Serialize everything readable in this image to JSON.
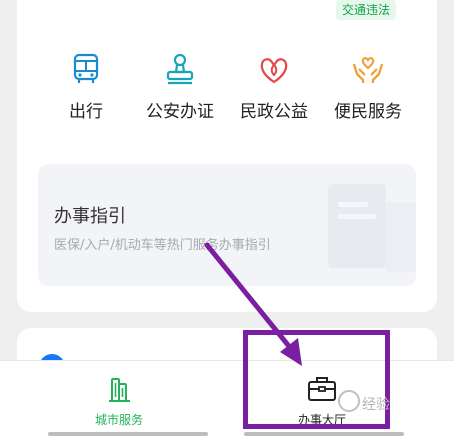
{
  "top_card": {
    "tag": "交通违法",
    "services": [
      {
        "label": "出行",
        "icon": "bus-icon"
      },
      {
        "label": "公安办证",
        "icon": "stamp-icon"
      },
      {
        "label": "民政公益",
        "icon": "heart-flower-icon"
      },
      {
        "label": "便民服务",
        "icon": "hands-heart-icon"
      }
    ],
    "guide": {
      "title": "办事指引",
      "subtitle": "医保/入户/机动车等热门服务办事指引"
    }
  },
  "tabbar": {
    "tabs": [
      {
        "label": "城市服务",
        "icon": "city-buildings-icon",
        "active": true
      },
      {
        "label": "办事大厅",
        "icon": "briefcase-icon",
        "active": false
      }
    ]
  },
  "watermark": "经验",
  "colors": {
    "accent_green": "#22b35a",
    "bus_blue": "#1a8bd0",
    "stamp_teal": "#18a4b8",
    "heart_red": "#e8464a",
    "hands_orange": "#f39b2e",
    "annotation_purple": "#7a1fa2"
  }
}
